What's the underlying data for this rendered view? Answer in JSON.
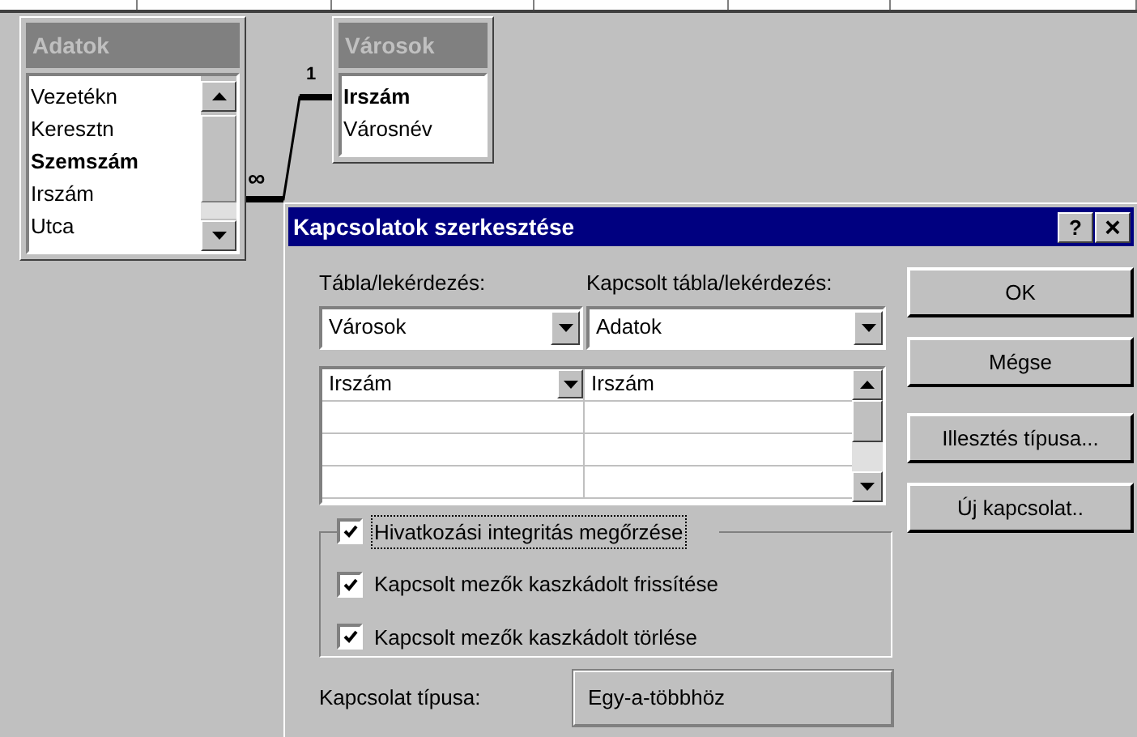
{
  "tables": [
    {
      "title": "Adatok",
      "fields": [
        {
          "name": "Vezetékn",
          "key": false
        },
        {
          "name": "Keresztn",
          "key": false
        },
        {
          "name": "Szemszám",
          "key": true
        },
        {
          "name": "Irszám",
          "key": false
        },
        {
          "name": "Utca",
          "key": false
        }
      ],
      "scrollable": true
    },
    {
      "title": "Városok",
      "fields": [
        {
          "name": "Irszám",
          "key": true
        },
        {
          "name": "Városnév",
          "key": false
        }
      ],
      "scrollable": false
    }
  ],
  "relationship": {
    "one_label": "1",
    "many_label": "∞"
  },
  "dialog": {
    "title": "Kapcsolatok szerkesztése",
    "help": "?",
    "close": "×",
    "table_label": "Tábla/lekérdezés:",
    "related_label": "Kapcsolt tábla/lekérdezés:",
    "table_value": "Városok",
    "related_value": "Adatok",
    "field_rows": [
      {
        "left": "Irszám",
        "right": "Irszám"
      },
      {
        "left": "",
        "right": ""
      },
      {
        "left": "",
        "right": ""
      },
      {
        "left": "",
        "right": ""
      }
    ],
    "checkboxes": [
      {
        "text": "Hivatkozási integritás megőrzése",
        "checked": true,
        "focused": true
      },
      {
        "text": "Kapcsolt mezők kaszkádolt frissítése",
        "checked": true,
        "focused": false
      },
      {
        "text": "Kapcsolt mezők kaszkádolt törlése",
        "checked": true,
        "focused": false
      }
    ],
    "type_label": "Kapcsolat típusa:",
    "type_value": "Egy-a-többhöz",
    "buttons": [
      "OK",
      "Mégse",
      "Illesztés típusa...",
      "Új kapcsolat.."
    ]
  }
}
